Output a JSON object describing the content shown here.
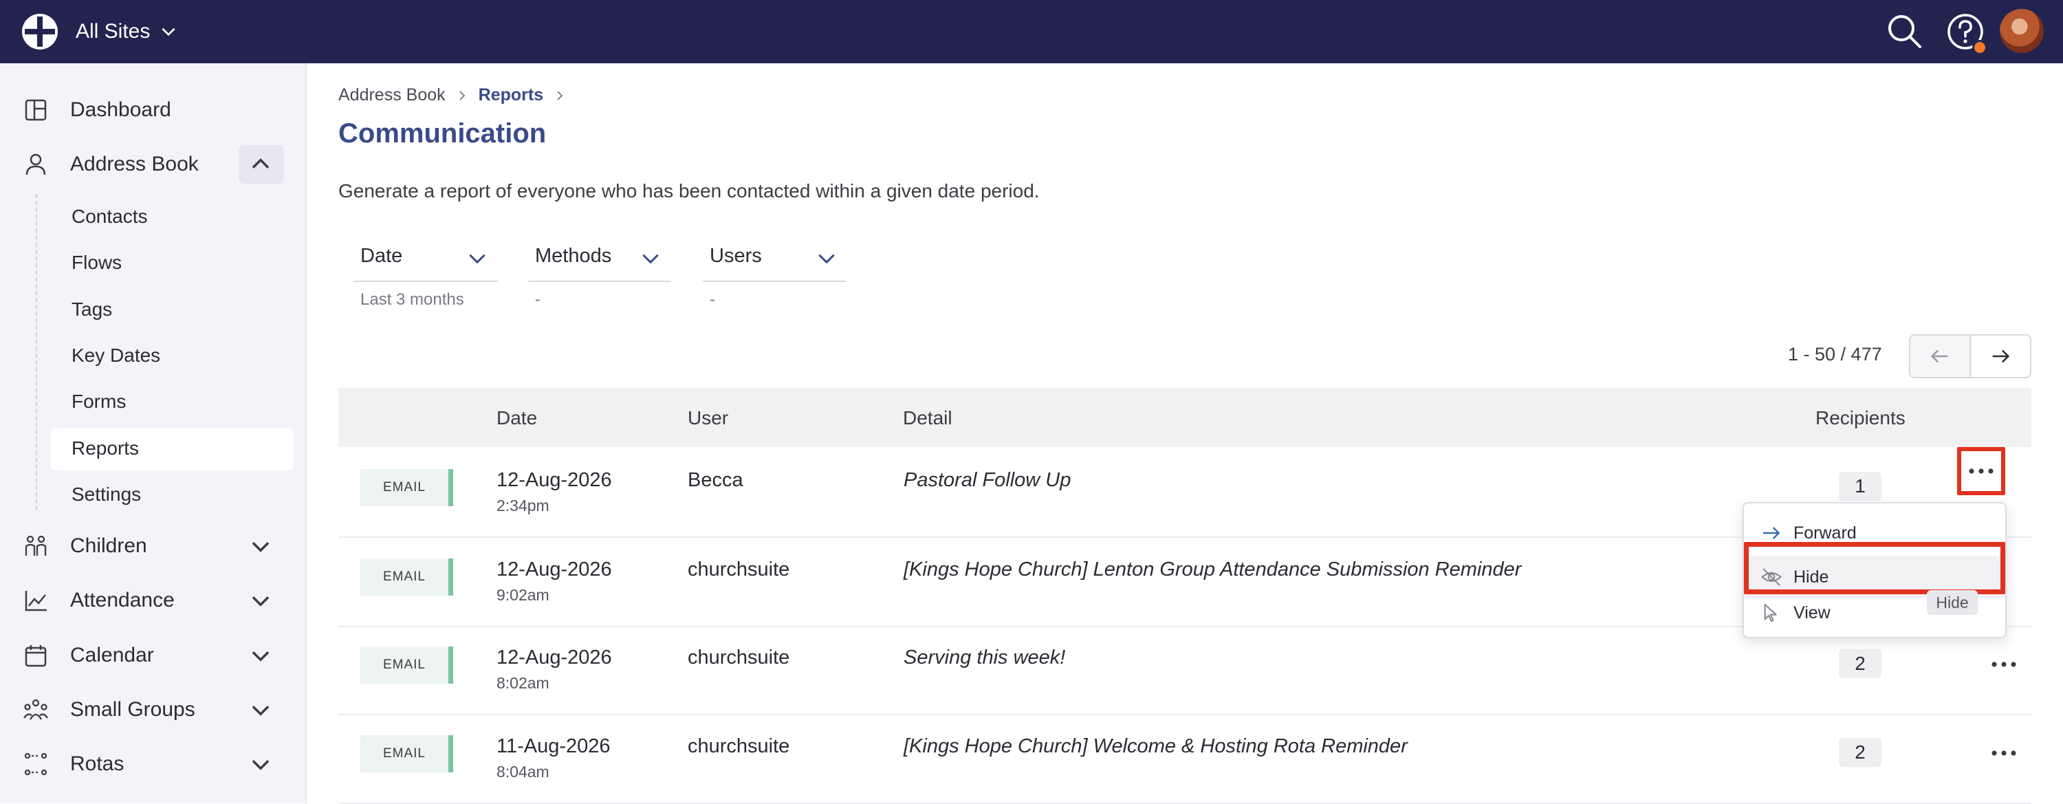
{
  "topbar": {
    "site_selector": "All Sites",
    "icons": {
      "search": "search-icon",
      "help": "help-icon",
      "avatar": "user-avatar"
    }
  },
  "sidebar": {
    "items": [
      {
        "label": "Dashboard",
        "icon": "dashboard-icon"
      },
      {
        "label": "Address Book",
        "icon": "person-icon",
        "expanded": true
      },
      {
        "label": "Children",
        "icon": "children-icon"
      },
      {
        "label": "Attendance",
        "icon": "chart-icon"
      },
      {
        "label": "Calendar",
        "icon": "calendar-icon"
      },
      {
        "label": "Small Groups",
        "icon": "group-icon"
      },
      {
        "label": "Rotas",
        "icon": "rota-icon"
      }
    ],
    "address_book_sub": [
      "Contacts",
      "Flows",
      "Tags",
      "Key Dates",
      "Forms",
      "Reports",
      "Settings"
    ],
    "active_sub": "Reports"
  },
  "breadcrumb": {
    "parent": "Address Book",
    "current": "Reports"
  },
  "page": {
    "title": "Communication",
    "description": "Generate a report of everyone who has been contacted within a given date period."
  },
  "filters": [
    {
      "label": "Date",
      "value": "Last 3 months"
    },
    {
      "label": "Methods",
      "value": "-"
    },
    {
      "label": "Users",
      "value": "-"
    }
  ],
  "pagination": {
    "text": "1 - 50 / 477"
  },
  "table": {
    "headers": {
      "date": "Date",
      "user": "User",
      "detail": "Detail",
      "recipients": "Recipients"
    },
    "rows": [
      {
        "method": "EMAIL",
        "date": "12-Aug-2026",
        "time": "2:34pm",
        "user": "Becca",
        "detail": "Pastoral Follow Up",
        "recipients": "1"
      },
      {
        "method": "EMAIL",
        "date": "12-Aug-2026",
        "time": "9:02am",
        "user": "churchsuite",
        "detail": "[Kings Hope Church] Lenton Group Attendance Submission Reminder",
        "recipients": ""
      },
      {
        "method": "EMAIL",
        "date": "12-Aug-2026",
        "time": "8:02am",
        "user": "churchsuite",
        "detail": "Serving this week!",
        "recipients": "2"
      },
      {
        "method": "EMAIL",
        "date": "11-Aug-2026",
        "time": "8:04am",
        "user": "churchsuite",
        "detail": "[Kings Hope Church] Welcome & Hosting Rota Reminder",
        "recipients": "2"
      }
    ]
  },
  "row_menu": {
    "items": [
      {
        "label": "Forward",
        "icon": "arrow-right-icon"
      },
      {
        "label": "Hide",
        "icon": "eye-slash-icon"
      },
      {
        "label": "View",
        "icon": "cursor-icon"
      }
    ],
    "tooltip": "Hide"
  },
  "colors": {
    "topbar": "#22244f",
    "accent": "#3a4a8a",
    "highlight": "#e0321f",
    "badge_stripe": "#7cc4a2"
  }
}
